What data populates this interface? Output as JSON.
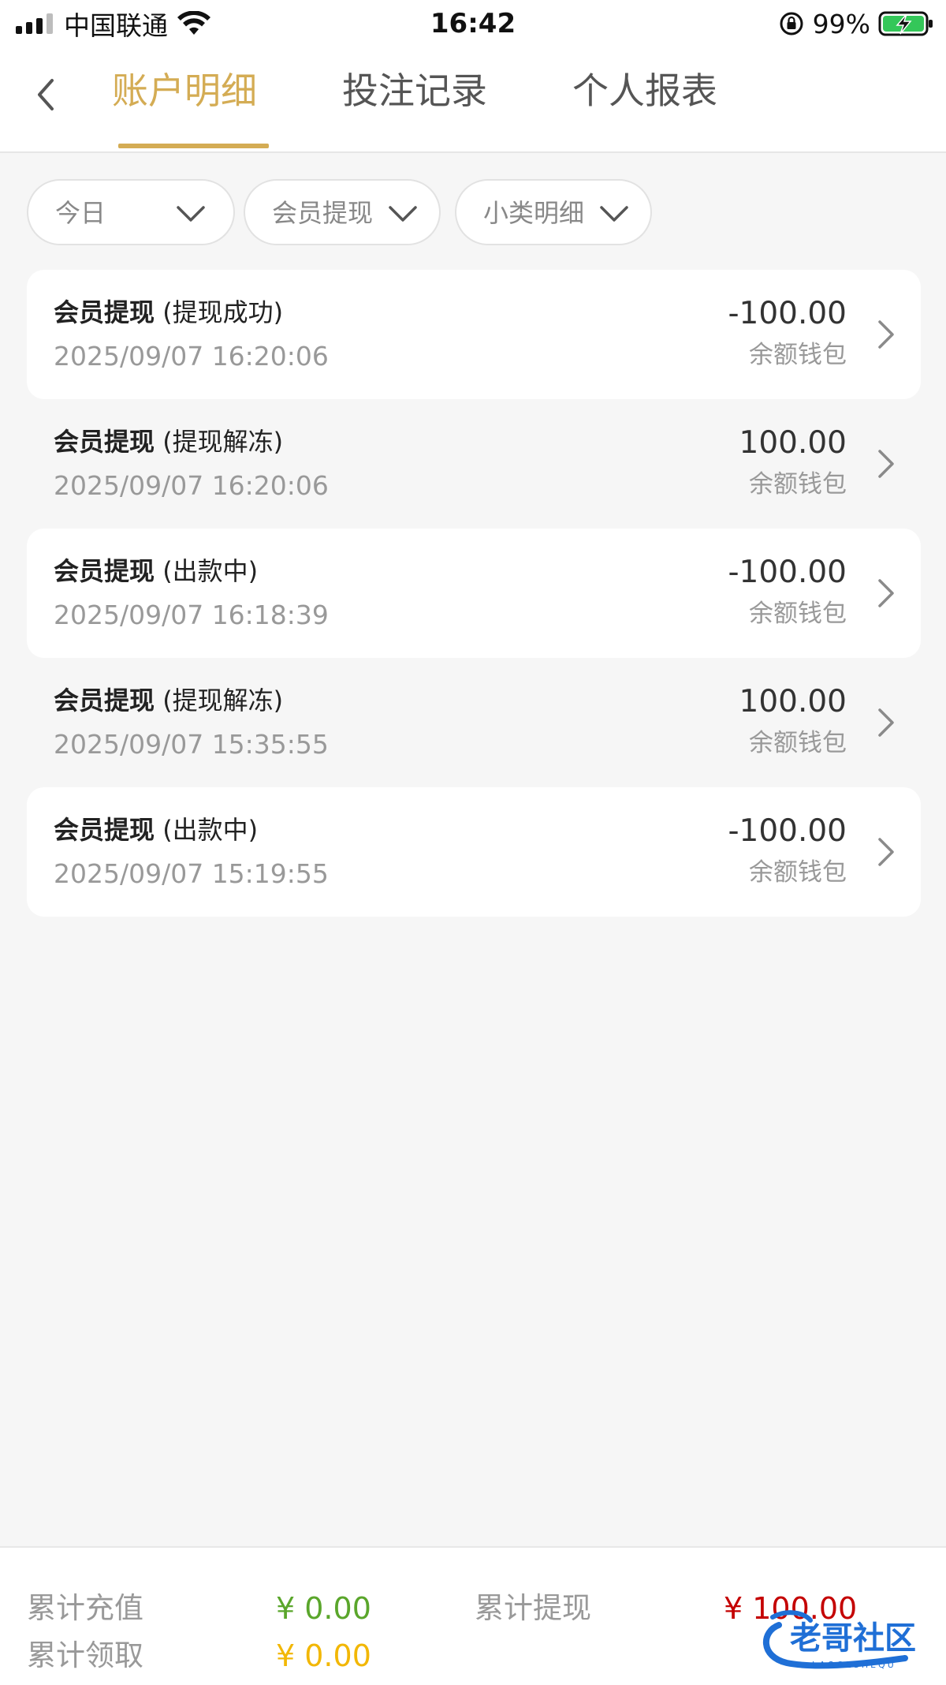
{
  "status_bar": {
    "carrier": "中国联通",
    "time": "16:42",
    "battery_percent": "99%",
    "signal_bars": 3,
    "signal_total": 4
  },
  "header": {
    "back_icon": "chevron-left-icon",
    "tabs": [
      {
        "label": "账户明细",
        "active": true
      },
      {
        "label": "投注记录",
        "active": false
      },
      {
        "label": "个人报表",
        "active": false
      }
    ],
    "active_color": "#d4ac54"
  },
  "filters": [
    {
      "label": "今日"
    },
    {
      "label": "会员提现"
    },
    {
      "label": "小类明细"
    }
  ],
  "records": [
    {
      "type": "会员提现",
      "status": "(提现成功)",
      "time": "2025/09/07 16:20:06",
      "amount": "-100.00",
      "wallet": "余额钱包"
    },
    {
      "type": "会员提现",
      "status": "(提现解冻)",
      "time": "2025/09/07 16:20:06",
      "amount": "100.00",
      "wallet": "余额钱包"
    },
    {
      "type": "会员提现",
      "status": "(出款中)",
      "time": "2025/09/07 16:18:39",
      "amount": "-100.00",
      "wallet": "余额钱包"
    },
    {
      "type": "会员提现",
      "status": "(提现解冻)",
      "time": "2025/09/07 15:35:55",
      "amount": "100.00",
      "wallet": "余额钱包"
    },
    {
      "type": "会员提现",
      "status": "(出款中)",
      "time": "2025/09/07 15:19:55",
      "amount": "-100.00",
      "wallet": "余额钱包"
    }
  ],
  "summary": {
    "recharge_label": "累计充值",
    "recharge_value": "¥ 0.00",
    "withdraw_label": "累计提现",
    "withdraw_value": "¥ 100.00",
    "claim_label": "累计领取",
    "claim_value": "¥ 0.00",
    "colors": {
      "recharge": "#5aa62b",
      "withdraw": "#c40000",
      "claim": "#f2b705"
    }
  },
  "watermark": {
    "text": "老哥社区",
    "subtext": "LAOGESHEQU"
  }
}
